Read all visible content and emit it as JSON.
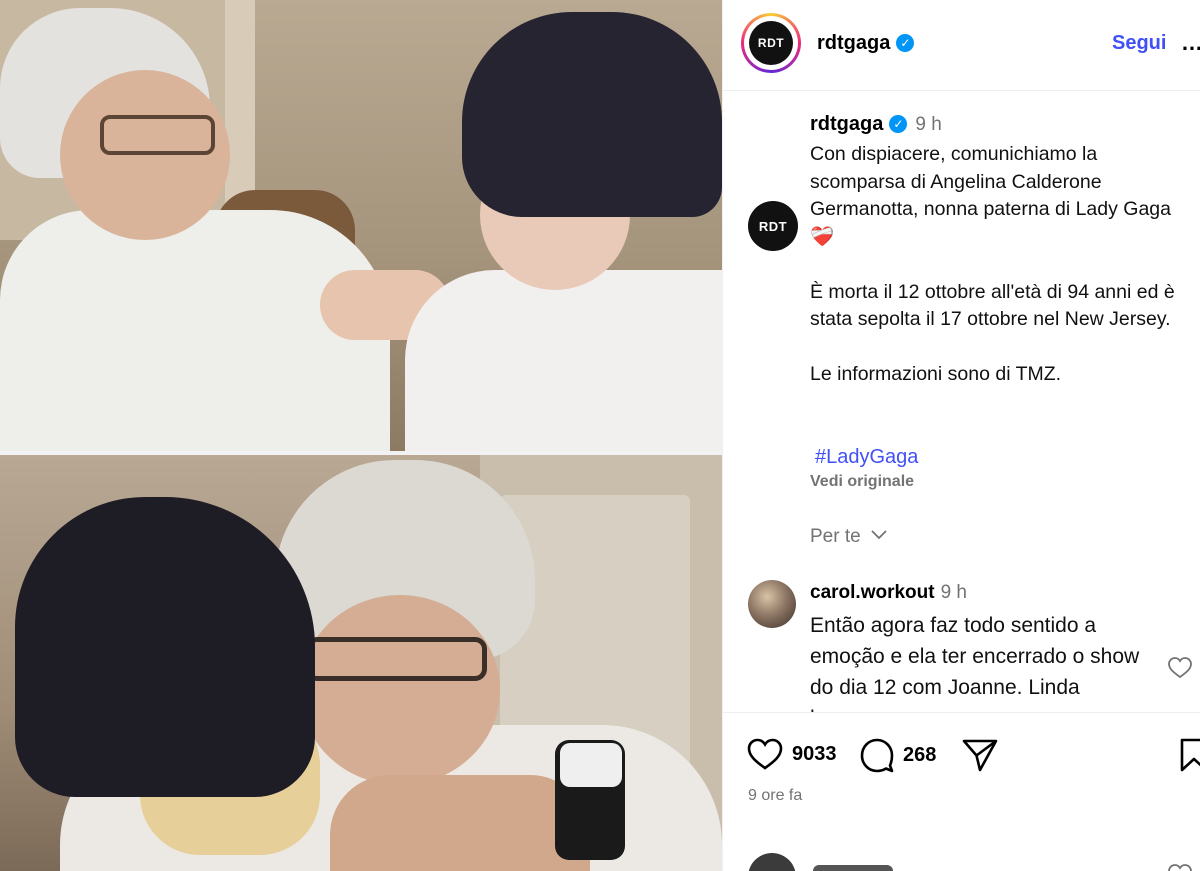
{
  "header": {
    "logo_text": "RDT",
    "username": "rdtgaga",
    "follow_label": "Segui",
    "more_label": "…"
  },
  "caption": {
    "username": "rdtgaga",
    "time": "9 h",
    "paragraph_1": "Con dispiacere, comunichiamo la scomparsa di Angelina Calderone Germanotta, nonna paterna di Lady Gaga",
    "emoji": "❤️‍🩹",
    "paragraph_2": "È morta il 12 ottobre all'età di 94 anni ed è stata sepolta il 17 ottobre nel New Jersey.",
    "paragraph_3": "Le informazioni sono di TMZ.",
    "hashtag": "#LadyGaga",
    "see_original": "Vedi originale",
    "for_you": "Per te"
  },
  "comment": {
    "username": "carol.workout",
    "time": "9 h",
    "text": "Então agora faz todo sentido a emoção e ela ter encerrado o show do dia 12 com Joanne. Linda homenagem"
  },
  "actions": {
    "likes": "9033",
    "comments": "268"
  },
  "post_time": "9 ore fa",
  "colors": {
    "link_blue": "#4150f7",
    "verified_blue": "#0095f6",
    "muted_text": "#737373"
  },
  "icons": [
    "verified-badge-icon",
    "more-options-icon",
    "chevron-down-icon",
    "like-heart-icon",
    "comment-bubble-icon",
    "share-plane-icon",
    "bookmark-icon",
    "broken-heart-emoji"
  ]
}
